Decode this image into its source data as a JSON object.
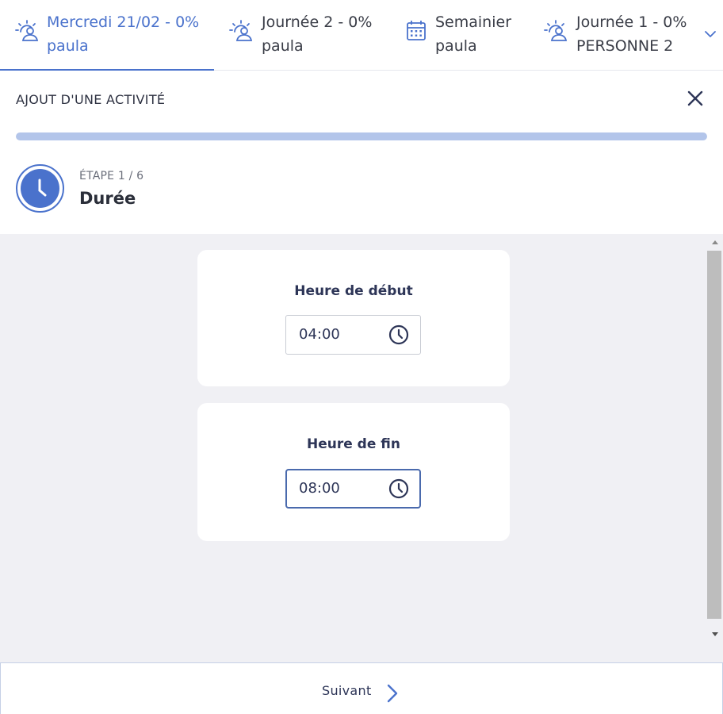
{
  "tabs": [
    {
      "line1": "Mercredi 21/02 - 0%",
      "line2": "paula",
      "icon": "sunrise-person-icon",
      "active": true
    },
    {
      "line1": "Journée 2 - 0%",
      "line2": "paula",
      "icon": "sunrise-person-icon",
      "active": false
    },
    {
      "line1": "Semainier",
      "line2": "paula",
      "icon": "calendar-icon",
      "active": false
    },
    {
      "line1": "Journée 1 - 0%",
      "line2": "PERSONNE 2",
      "icon": "sunrise-person-icon",
      "active": false
    }
  ],
  "header": {
    "title": "AJOUT D'UNE ACTIVITÉ",
    "progress": 1
  },
  "step": {
    "label": "ÉTAPE 1 / 6",
    "name": "Durée",
    "icon": "clock-icon"
  },
  "fields": {
    "start": {
      "label": "Heure de début",
      "value": "04:00"
    },
    "end": {
      "label": "Heure de fin",
      "value": "08:00"
    }
  },
  "footer": {
    "next_label": "Suivant"
  },
  "colors": {
    "accent": "#4a72cc",
    "progress": "#b3c5ea",
    "content_bg": "#f0f0f4"
  }
}
